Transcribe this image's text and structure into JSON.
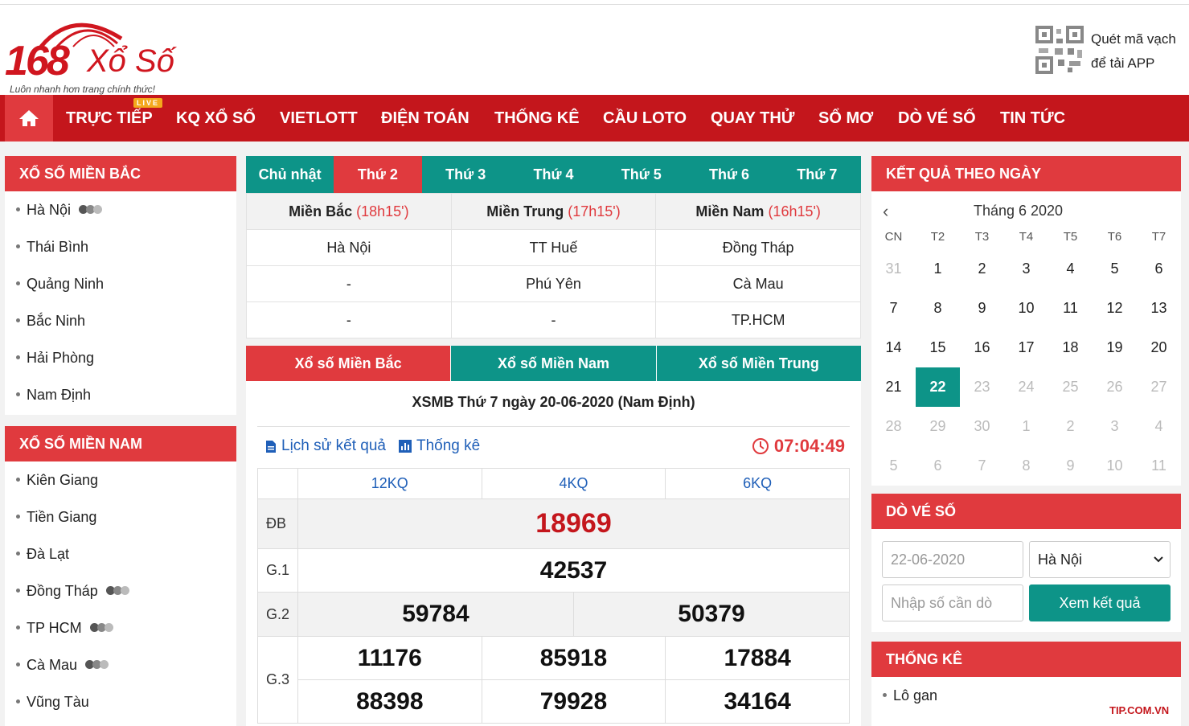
{
  "header": {
    "logo_num": "168",
    "logo_text": "Xổ Số",
    "tagline": "Luôn nhanh hơn trang chính thức!",
    "qr_line1": "Quét mã vạch",
    "qr_line2": "để tải APP"
  },
  "nav": {
    "items": [
      "TRỰC TIẾP",
      "KQ XỔ SỐ",
      "VIETLOTT",
      "ĐIỆN TOÁN",
      "THỐNG KÊ",
      "CẦU LOTO",
      "QUAY THỬ",
      "SỔ MƠ",
      "DÒ VÉ SỐ",
      "TIN TỨC"
    ],
    "live_badge": "LIVE"
  },
  "sidebar_north": {
    "title": "XỔ SỐ MIỀN BẮC",
    "items": [
      "Hà Nội",
      "Thái Bình",
      "Quảng Ninh",
      "Bắc Ninh",
      "Hải Phòng",
      "Nam Định"
    ]
  },
  "sidebar_south": {
    "title": "XỔ SỐ MIỀN NAM",
    "items": [
      "Kiên Giang",
      "Tiền Giang",
      "Đà Lạt",
      "Đồng Tháp",
      "TP HCM",
      "Cà Mau",
      "Vũng Tàu"
    ]
  },
  "day_tabs": [
    "Chủ nhật",
    "Thứ 2",
    "Thứ 3",
    "Thứ 4",
    "Thứ 5",
    "Thứ 6",
    "Thứ 7"
  ],
  "schedule": {
    "headers": [
      {
        "name": "Miền Bắc",
        "time": "(18h15')"
      },
      {
        "name": "Miền Trung",
        "time": "(17h15')"
      },
      {
        "name": "Miền Nam",
        "time": "(16h15')"
      }
    ],
    "rows": [
      [
        "Hà Nội",
        "TT Huế",
        "Đồng Tháp"
      ],
      [
        "-",
        "Phú Yên",
        "Cà Mau"
      ],
      [
        "-",
        "-",
        "TP.HCM"
      ]
    ]
  },
  "region_tabs": [
    "Xổ số Miền Bắc",
    "Xổ số Miền Nam",
    "Xổ số Miền Trung"
  ],
  "result": {
    "title": "XSMB Thứ 7 ngày 20-06-2020 (Nam Định)",
    "history_link": "Lịch sử kết quả",
    "stats_link": "Thống kê",
    "timer": "07:04:49",
    "kq_cols": [
      "12KQ",
      "4KQ",
      "6KQ"
    ],
    "db_label": "ĐB",
    "db": "18969",
    "g1_label": "G.1",
    "g1": "42537",
    "g2_label": "G.2",
    "g2": [
      "59784",
      "50379"
    ],
    "g3_label": "G.3",
    "g3": [
      "11176",
      "85918",
      "17884",
      "88398",
      "79928",
      "34164"
    ]
  },
  "calendar": {
    "title": "KẾT QUẢ THEO NGÀY",
    "month": "Tháng 6 2020",
    "weekdays": [
      "CN",
      "T2",
      "T3",
      "T4",
      "T5",
      "T6",
      "T7"
    ],
    "weeks": [
      [
        "31",
        "1",
        "2",
        "3",
        "4",
        "5",
        "6"
      ],
      [
        "7",
        "8",
        "9",
        "10",
        "11",
        "12",
        "13"
      ],
      [
        "14",
        "15",
        "16",
        "17",
        "18",
        "19",
        "20"
      ],
      [
        "21",
        "22",
        "23",
        "24",
        "25",
        "26",
        "27"
      ],
      [
        "28",
        "29",
        "30",
        "1",
        "2",
        "3",
        "4"
      ],
      [
        "5",
        "6",
        "7",
        "8",
        "9",
        "10",
        "11"
      ]
    ]
  },
  "dove": {
    "title": "DÒ VÉ SỐ",
    "date_value": "22-06-2020",
    "province": "Hà Nội",
    "number_placeholder": "Nhập số cần dò",
    "button": "Xem kết quả"
  },
  "stats": {
    "title": "THỐNG KÊ",
    "items": [
      "Lô gan"
    ]
  },
  "watermark": "TIP.COM.VN",
  "colors": {
    "red": "#c4161c",
    "teal": "#0d9488",
    "link": "#1f5fb8"
  }
}
